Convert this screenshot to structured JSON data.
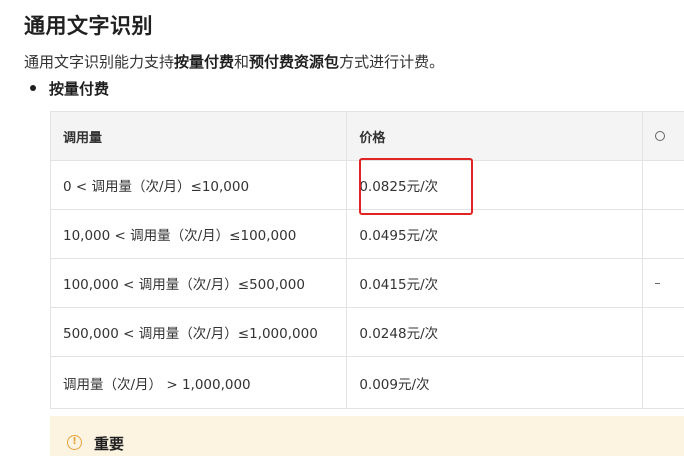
{
  "section": {
    "title": "通用文字识别",
    "intro_prefix": "通用文字识别能力支持",
    "intro_bold1": "按量付费",
    "intro_mid": "和",
    "intro_bold2": "预付费资源包",
    "intro_suffix": "方式进行计费。"
  },
  "bullet": {
    "label": "按量付费"
  },
  "table": {
    "headers": [
      "调用量",
      "价格"
    ],
    "rows": [
      {
        "usage": "0 < 调用量（次/月）≤10,000",
        "price": "0.0825元/次"
      },
      {
        "usage": "10,000 < 调用量（次/月）≤100,000",
        "price": "0.0495元/次"
      },
      {
        "usage": "100,000 < 调用量（次/月）≤500,000",
        "price": "0.0415元/次"
      },
      {
        "usage": "500,000 < 调用量（次/月）≤1,000,000",
        "price": "0.0248元/次"
      },
      {
        "usage": "调用量（次/月） > 1,000,000",
        "price": "0.009元/次"
      }
    ]
  },
  "notice": {
    "title": "重要",
    "icon": "warning-circle-icon"
  },
  "colors": {
    "highlight": "#e02424",
    "notice_bg": "#fdf3e1",
    "header_bg": "#f4f4f4"
  }
}
